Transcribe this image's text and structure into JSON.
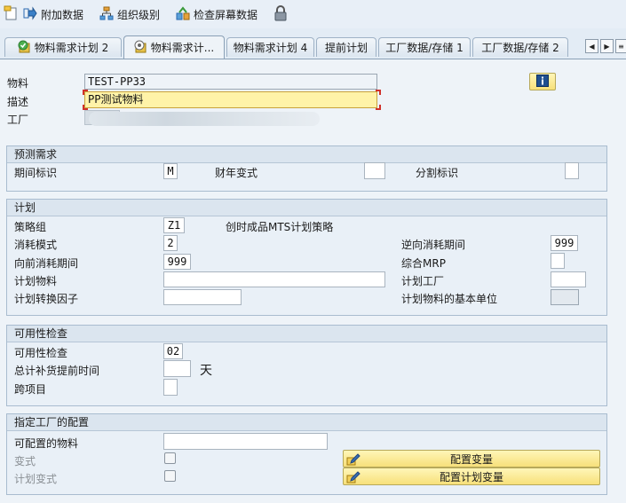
{
  "toolbar": {
    "add_data_label": "附加数据",
    "org_level_label": "组织级别",
    "check_screen_label": "检查屏幕数据"
  },
  "tabs": [
    {
      "label": "物料需求计划 2"
    },
    {
      "label": "物料需求计..."
    },
    {
      "label": "物料需求计划 4"
    },
    {
      "label": "提前计划"
    },
    {
      "label": "工厂数据/存储 1"
    },
    {
      "label": "工厂数据/存储 2"
    }
  ],
  "header": {
    "material_label": "物料",
    "material_value": "TEST-PP33",
    "description_label": "描述",
    "description_value": "PP测试物料",
    "plant_label": "工厂"
  },
  "forecast": {
    "title": "预测需求",
    "period_label": "期间标识",
    "period_value": "M",
    "fiscal_label": "财年变式",
    "fiscal_value": "",
    "split_label": "分割标识"
  },
  "planning": {
    "title": "计划",
    "strategy_label": "策略组",
    "strategy_value": "Z1",
    "strategy_desc": "创时成品MTS计划策略",
    "consumption_label": "消耗模式",
    "consumption_value": "2",
    "bwd_label": "逆向消耗期间",
    "bwd_value": "999",
    "fwd_label": "向前消耗期间",
    "fwd_value": "999",
    "mixed_mrp_label": "综合MRP",
    "mixed_mrp_value": "",
    "planning_material_label": "计划物料",
    "planning_material_value": "",
    "planning_plant_label": "计划工厂",
    "planning_plant_value": "",
    "conv_factor_label": "计划转换因子",
    "conv_factor_value": "",
    "base_unit_label": "计划物料的基本单位",
    "base_unit_value": ""
  },
  "availability": {
    "title": "可用性检查",
    "check_label": "可用性检查",
    "check_value": "02",
    "total_lead_label": "总计补货提前时间",
    "total_lead_value": "",
    "total_lead_unit": "天",
    "cross_project_label": "跨项目",
    "cross_project_value": ""
  },
  "config": {
    "title": "指定工厂的配置",
    "configurable_label": "可配置的物料",
    "configurable_value": "",
    "variant_label": "变式",
    "planning_variant_label": "计划变式",
    "config_variant_button": "配置变量",
    "config_planning_variant_button": "配置计划变量"
  }
}
